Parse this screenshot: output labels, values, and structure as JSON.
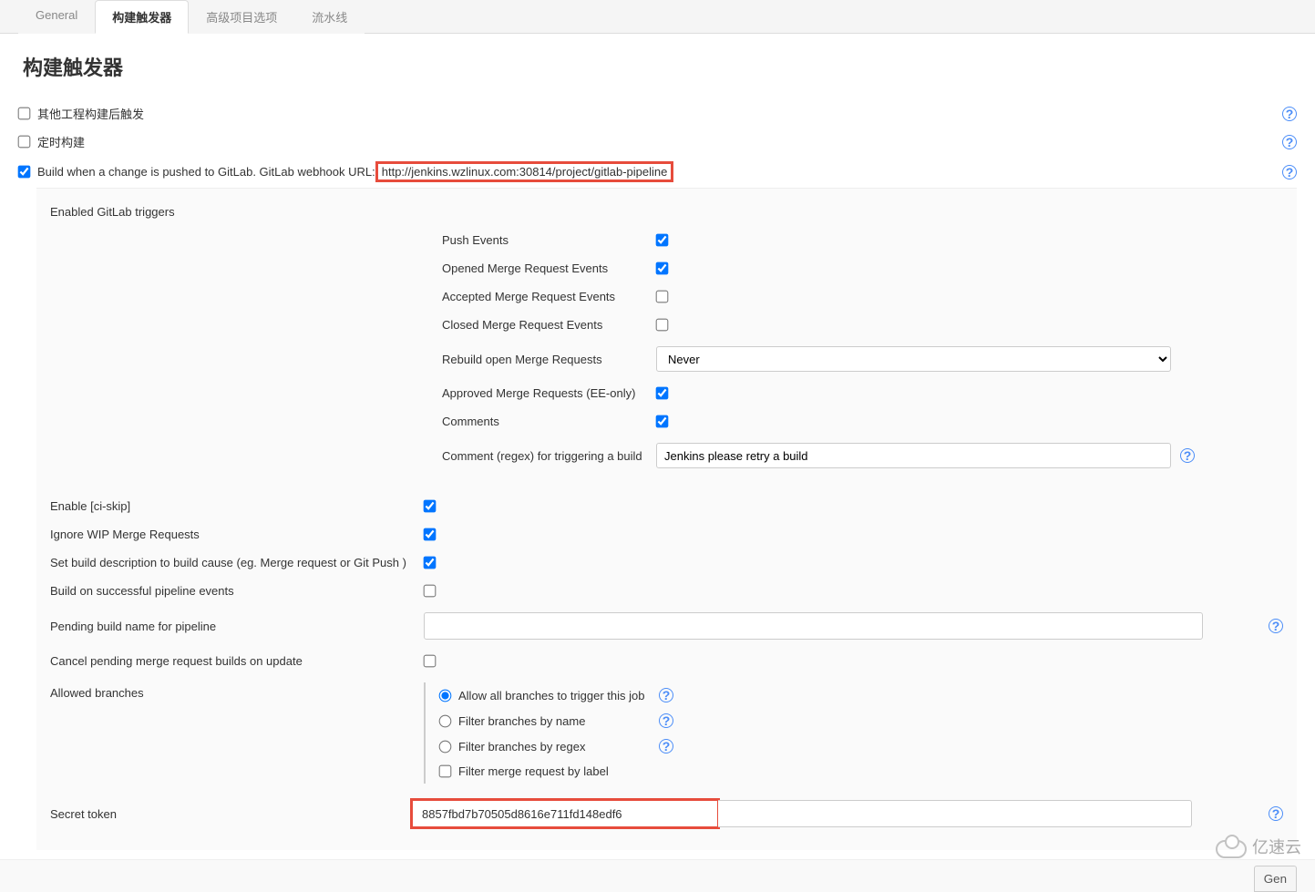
{
  "tabs": {
    "general": "General",
    "triggers": "构建触发器",
    "advanced": "高级项目选项",
    "pipeline": "流水线"
  },
  "section_title": "构建触发器",
  "checks": {
    "after_other": "其他工程构建后触发",
    "timer": "定时构建",
    "gitlab_prefix": "Build when a change is pushed to GitLab. GitLab webhook URL:",
    "gitlab_url": " http://jenkins.wzlinux.com:30814/project/gitlab-pipeline"
  },
  "gitlab": {
    "triggers_label": "Enabled GitLab triggers",
    "push": "Push Events",
    "opened_mr": "Opened Merge Request Events",
    "accepted_mr": "Accepted Merge Request Events",
    "closed_mr": "Closed Merge Request Events",
    "rebuild_label": "Rebuild open Merge Requests",
    "rebuild_value": "Never",
    "approved_mr": "Approved Merge Requests (EE-only)",
    "comments": "Comments",
    "comment_regex_label": "Comment (regex) for triggering a build",
    "comment_regex_value": "Jenkins please retry a build",
    "ci_skip": "Enable [ci-skip]",
    "ignore_wip": "Ignore WIP Merge Requests",
    "set_desc": "Set build description to build cause (eg. Merge request or Git Push )",
    "build_on_success": "Build on successful pipeline events",
    "pending_name": "Pending build name for pipeline",
    "cancel_pending": "Cancel pending merge request builds on update",
    "allowed_branches": "Allowed branches",
    "branch_all": "Allow all branches to trigger this job",
    "branch_name": "Filter branches by name",
    "branch_regex": "Filter branches by regex",
    "branch_label": "Filter merge request by label",
    "secret_label": "Secret token",
    "secret_value": "8857fbd7b70505d8616e711fd148edf6"
  },
  "buttons": {
    "generate": "Gen"
  },
  "watermark": "亿速云"
}
